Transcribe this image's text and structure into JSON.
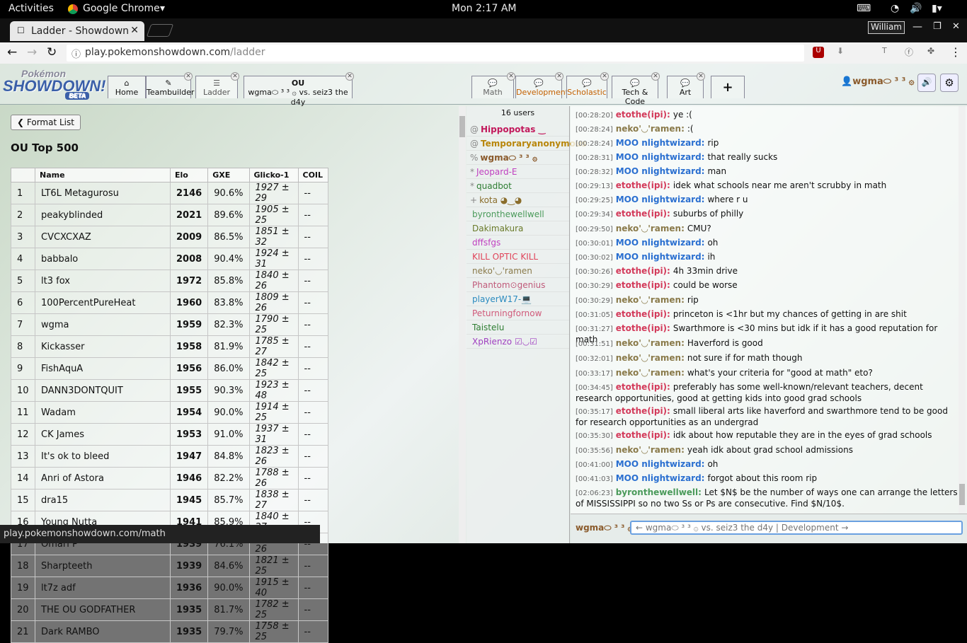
{
  "gnome": {
    "activities": "Activities",
    "app": "Google Chrome",
    "clock": "Mon  2:17 AM",
    "user": "William"
  },
  "browser": {
    "tab_title": "Ladder - Showdown",
    "url_host": "play.pokemonshowdown.com",
    "url_path": "/ladder",
    "status_url": "play.pokemonshowdown.com/math"
  },
  "logo": {
    "line1": "Pokémon",
    "line2": "SHOWDOWN!",
    "beta": "BETA"
  },
  "main_tabs": [
    {
      "label": "Home"
    },
    {
      "label": "Teambuilder"
    },
    {
      "label": "Ladder"
    },
    {
      "label": "OU",
      "sub": "wgma⬭ ³ ³ ۞ vs. seiz3 the d4y"
    }
  ],
  "room_tabs": [
    {
      "label": "Math"
    },
    {
      "label": "Development"
    },
    {
      "label": "Scholastic"
    },
    {
      "label": "Tech & Code"
    },
    {
      "label": "Art"
    }
  ],
  "add_tab": "+",
  "username": "wgma⬭ ³ ³ ۞",
  "ladder": {
    "back_label": "Format List",
    "title": "OU Top 500",
    "headers": [
      "",
      "Name",
      "Elo",
      "GXE",
      "Glicko-1",
      "COIL"
    ],
    "rows": [
      [
        "1",
        "LT6L Metagurosu",
        "2146",
        "90.6%",
        "1927 ± 29",
        "--"
      ],
      [
        "2",
        "peakyblinded",
        "2021",
        "89.6%",
        "1905 ± 25",
        "--"
      ],
      [
        "3",
        "CVCXCXAZ",
        "2009",
        "86.5%",
        "1851 ± 32",
        "--"
      ],
      [
        "4",
        "babbalo",
        "2008",
        "90.4%",
        "1924 ± 31",
        "--"
      ],
      [
        "5",
        "lt3 fox",
        "1972",
        "85.8%",
        "1840 ± 26",
        "--"
      ],
      [
        "6",
        "100PercentPureHeat",
        "1960",
        "83.8%",
        "1809 ± 26",
        "--"
      ],
      [
        "7",
        "wgma",
        "1959",
        "82.3%",
        "1790 ± 25",
        "--"
      ],
      [
        "8",
        "Kickasser",
        "1958",
        "81.9%",
        "1785 ± 27",
        "--"
      ],
      [
        "9",
        "FishAquA",
        "1956",
        "86.0%",
        "1842 ± 25",
        "--"
      ],
      [
        "10",
        "DANN3DONTQUIT",
        "1955",
        "90.3%",
        "1923 ± 48",
        "--"
      ],
      [
        "11",
        "Wadam",
        "1954",
        "90.0%",
        "1914 ± 25",
        "--"
      ],
      [
        "12",
        "CK James",
        "1953",
        "91.0%",
        "1937 ± 31",
        "--"
      ],
      [
        "13",
        "It's ok to bleed",
        "1947",
        "84.8%",
        "1823 ± 26",
        "--"
      ],
      [
        "14",
        "Anri of Astora",
        "1946",
        "82.2%",
        "1788 ± 26",
        "--"
      ],
      [
        "15",
        "dra15",
        "1945",
        "85.7%",
        "1838 ± 27",
        "--"
      ],
      [
        "16",
        "Young Nutta",
        "1941",
        "85.9%",
        "1840 ± 27",
        "--"
      ],
      [
        "17",
        "Omari P",
        "1939",
        "76.1%",
        "1719 ± 26",
        "--"
      ],
      [
        "18",
        "Sharpteeth",
        "1939",
        "84.6%",
        "1821 ± 25",
        "--"
      ],
      [
        "19",
        "lt7z adf",
        "1936",
        "90.0%",
        "1915 ± 40",
        "--"
      ],
      [
        "20",
        "THE OU GODFATHER",
        "1935",
        "81.7%",
        "1782 ± 25",
        "--"
      ],
      [
        "21",
        "Dark RAMBO",
        "1935",
        "79.7%",
        "1758 ± 25",
        "--"
      ]
    ]
  },
  "userlist": {
    "count": "16 users",
    "users": [
      {
        "r": "@",
        "n": "Hippopotas ‿",
        "c": "#c2185b",
        "b": true
      },
      {
        "r": "@",
        "n": "Temporaryanonymous",
        "c": "#b8860b",
        "b": true
      },
      {
        "r": "%",
        "n": "wgma⬭ ³ ³ ۞",
        "c": "#8a5a2b",
        "b": true
      },
      {
        "r": "*",
        "n": "Jeopard-E",
        "c": "#c040c0",
        "b": false
      },
      {
        "r": "*",
        "n": "quadbot",
        "c": "#2e7d32",
        "b": false
      },
      {
        "r": "+",
        "n": "kota ◕‿◕",
        "c": "#8a6d2b",
        "b": false
      },
      {
        "r": "",
        "n": "byronthewellwell",
        "c": "#4a9a5a",
        "b": false
      },
      {
        "r": "",
        "n": "Dakimakura",
        "c": "#6a7a2a",
        "b": false
      },
      {
        "r": "",
        "n": "dffsfgs",
        "c": "#c040c0",
        "b": false
      },
      {
        "r": "",
        "n": "KILL OPTIC KILL",
        "c": "#e0445a",
        "b": false
      },
      {
        "r": "",
        "n": "neko'◡'ramen",
        "c": "#8a7a4a",
        "b": false
      },
      {
        "r": "",
        "n": "Phantom⊙genius",
        "c": "#c05a7a",
        "b": false
      },
      {
        "r": "",
        "n": "playerW17-💻",
        "c": "#2a8abf",
        "b": false
      },
      {
        "r": "",
        "n": "Peturningfornow",
        "c": "#d05a7a",
        "b": false
      },
      {
        "r": "",
        "n": "Taistelu",
        "c": "#2e7d32",
        "b": false
      },
      {
        "r": "",
        "n": "XpRienzo ☑◡☑",
        "c": "#a040c0",
        "b": false
      }
    ]
  },
  "chat": [
    {
      "t": "[00:28:20]",
      "u": "etothe(ipi):",
      "c": "#d33a5a",
      "m": "ye :("
    },
    {
      "t": "[00:28:24]",
      "u": "neko'◡'ramen:",
      "c": "#8a7a4a",
      "m": ":("
    },
    {
      "t": "[00:28:24]",
      "u": "MOO nlightwizard:",
      "c": "#2a6fd0",
      "m": "rip"
    },
    {
      "t": "[00:28:31]",
      "u": "MOO nlightwizard:",
      "c": "#2a6fd0",
      "m": "that really sucks"
    },
    {
      "t": "[00:28:32]",
      "u": "MOO nlightwizard:",
      "c": "#2a6fd0",
      "m": "man"
    },
    {
      "t": "[00:29:13]",
      "u": "etothe(ipi):",
      "c": "#d33a5a",
      "m": "idek what schools near me aren't scrubby in math"
    },
    {
      "t": "[00:29:25]",
      "u": "MOO nlightwizard:",
      "c": "#2a6fd0",
      "m": "where r u"
    },
    {
      "t": "[00:29:34]",
      "u": "etothe(ipi):",
      "c": "#d33a5a",
      "m": "suburbs of philly"
    },
    {
      "t": "[00:29:50]",
      "u": "neko'◡'ramen:",
      "c": "#8a7a4a",
      "m": "CMU?"
    },
    {
      "t": "[00:30:01]",
      "u": "MOO nlightwizard:",
      "c": "#2a6fd0",
      "m": "oh"
    },
    {
      "t": "[00:30:02]",
      "u": "MOO nlightwizard:",
      "c": "#2a6fd0",
      "m": "ih"
    },
    {
      "t": "[00:30:26]",
      "u": "etothe(ipi):",
      "c": "#d33a5a",
      "m": "4h 33min drive"
    },
    {
      "t": "[00:30:29]",
      "u": "etothe(ipi):",
      "c": "#d33a5a",
      "m": "could be worse"
    },
    {
      "t": "[00:30:29]",
      "u": "neko'◡'ramen:",
      "c": "#8a7a4a",
      "m": "rip"
    },
    {
      "t": "[00:31:05]",
      "u": "etothe(ipi):",
      "c": "#d33a5a",
      "m": "princeton is <1hr but my chances of getting in are shit"
    },
    {
      "t": "[00:31:27]",
      "u": "etothe(ipi):",
      "c": "#d33a5a",
      "m": "Swarthmore is <30 mins but idk if it has a good reputation for math"
    },
    {
      "t": "[00:31:51]",
      "u": "neko'◡'ramen:",
      "c": "#8a7a4a",
      "m": "Haverford is good"
    },
    {
      "t": "[00:32:01]",
      "u": "neko'◡'ramen:",
      "c": "#8a7a4a",
      "m": "not sure if for math though"
    },
    {
      "t": "[00:33:17]",
      "u": "neko'◡'ramen:",
      "c": "#8a7a4a",
      "m": "what's your criteria for \"good at math\" eto?"
    },
    {
      "t": "[00:34:45]",
      "u": "etothe(ipi):",
      "c": "#d33a5a",
      "m": "preferably has some well-known/relevant teachers, decent research opportunities, good at getting kids into good grad schools"
    },
    {
      "t": "[00:35:17]",
      "u": "etothe(ipi):",
      "c": "#d33a5a",
      "m": "small liberal arts like haverford and swarthmore tend to be good for research opportunities as an undergrad"
    },
    {
      "t": "[00:35:30]",
      "u": "etothe(ipi):",
      "c": "#d33a5a",
      "m": "idk about how reputable they are in the eyes of grad schools"
    },
    {
      "t": "[00:35:56]",
      "u": "neko'◡'ramen:",
      "c": "#8a7a4a",
      "m": "yeah idk about grad school admissions"
    },
    {
      "t": "[00:41:00]",
      "u": "MOO nlightwizard:",
      "c": "#2a6fd0",
      "m": "oh"
    },
    {
      "t": "[00:41:03]",
      "u": "MOO nlightwizard:",
      "c": "#2a6fd0",
      "m": "forgot about this room rip"
    },
    {
      "t": "[02:06:23]",
      "u": "byronthewellwell:",
      "c": "#4a9a5a",
      "m": "Let $N$ be the number of ways one can arrange the letters of MISSISSIPPI so no two Ss or Ps are consecutive. Find $N/10$."
    }
  ],
  "input": {
    "placeholder": "← wgma⬭ ³ ³ ۞ vs. seiz3 the d4y | Development →"
  }
}
